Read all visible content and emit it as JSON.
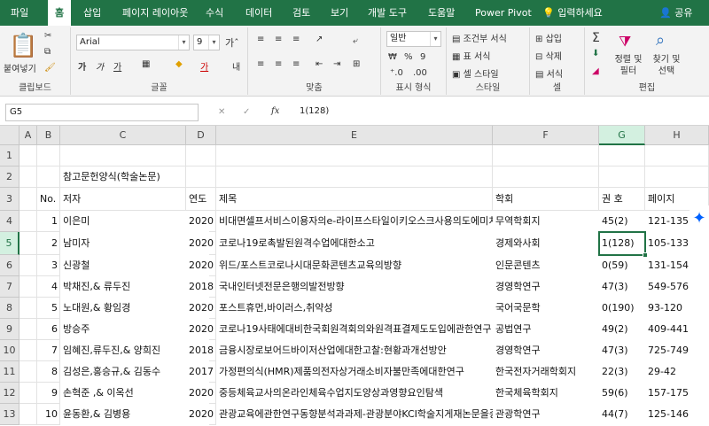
{
  "tabs": [
    "파일",
    "홈",
    "삽입",
    "페이지 레이아웃",
    "수식",
    "데이터",
    "검토",
    "보기",
    "개발 도구",
    "도움말",
    "Power Pivot"
  ],
  "active_tab": "홈",
  "tell_me": "입력하세요",
  "share": "공유",
  "ribbon": {
    "paste": "붙여넣기",
    "clipboard": "클립보드",
    "font_name": "Arial",
    "font_size": "9",
    "font_group": "글꼴",
    "align_group": "맞춤",
    "number_format": "일반",
    "number_group": "표시 형식",
    "cond_format": "조건부 서식",
    "table_format": "표 서식",
    "cell_style": "셀 스타일",
    "style_group": "스타일",
    "insert": "삽입",
    "delete": "삭제",
    "format": "서식",
    "cells_group": "셀",
    "sort_filter": "정렬 및 필터",
    "find_select": "찾기 및 선택",
    "edit_group": "편집"
  },
  "formula_bar": {
    "name_box": "G5",
    "formula": "1(128)"
  },
  "columns": [
    "A",
    "B",
    "C",
    "D",
    "E",
    "F",
    "G",
    "H"
  ],
  "selected_column": "G",
  "selected_row": "5",
  "title": "참고문헌양식(학술논문)",
  "header": {
    "no": "No.",
    "author": "저자",
    "year": "연도",
    "subject": "제목",
    "journal": "학회",
    "vol": "권 호",
    "page": "페이지"
  },
  "rows": [
    {
      "row": "4",
      "no": "1",
      "author": "이은미",
      "year": "2020",
      "subject": "비대면셀프서비스이용자의e-라이프스타일이키오스크사용의도에미치는영향",
      "journal": "무역학회지",
      "vol": "45(2)",
      "page": "121-135"
    },
    {
      "row": "5",
      "no": "2",
      "author": "남미자",
      "year": "2020",
      "subject": "코로나19로촉발된원격수업에대한소고",
      "journal": "경제와사회",
      "vol": "1(128)",
      "page": "105-133"
    },
    {
      "row": "6",
      "no": "3",
      "author": "신광철",
      "year": "2020",
      "subject": "위드/포스트코로나시대문화콘텐츠교육의방향",
      "journal": "인문콘텐츠",
      "vol": "0(59)",
      "page": "131-154"
    },
    {
      "row": "7",
      "no": "4",
      "author": "박채진,& 류두진",
      "year": "2018",
      "subject": "국내인터넷전문은행의발전방향",
      "journal": "경영학연구",
      "vol": "47(3)",
      "page": "549-576"
    },
    {
      "row": "8",
      "no": "5",
      "author": "노대원,& 황임경",
      "year": "2020",
      "subject": "포스트휴먼,바이러스,취약성",
      "journal": "국어국문학",
      "vol": "0(190)",
      "page": "93-120"
    },
    {
      "row": "9",
      "no": "6",
      "author": "방승주",
      "year": "2020",
      "subject": "코로나19사태에대비한국회원격회의와원격표결제도도입에관한연구",
      "journal": "공법연구",
      "vol": "49(2)",
      "page": "409-441"
    },
    {
      "row": "10",
      "no": "7",
      "author": "임혜진,류두진,& 양희진",
      "year": "2018",
      "subject": "금융시장로보어드바이저산업에대한고찰:현황과개선방안",
      "journal": "경영학연구",
      "vol": "47(3)",
      "page": "725-749"
    },
    {
      "row": "11",
      "no": "8",
      "author": "김성은,홍승규,& 김동수",
      "year": "2017",
      "subject": "가정편의식(HMR)제품의전자상거래소비자불만족에대한연구",
      "journal": "한국전자거래학회지",
      "vol": "22(3)",
      "page": "29-42"
    },
    {
      "row": "12",
      "no": "9",
      "author": "손혁준 ,& 이옥선",
      "year": "2020",
      "subject": "중등체육교사의온라인체육수업지도양상과영향요인탐색",
      "journal": "한국체육학회지",
      "vol": "59(6)",
      "page": "157-175"
    },
    {
      "row": "13",
      "no": "10",
      "author": "윤동환,& 김병용",
      "year": "2020",
      "subject": "관광교육에관한연구동향분석과과제-관광분야KCI학술지게재논문을중심으로",
      "journal": "관광학연구",
      "vol": "44(7)",
      "page": "125-146"
    }
  ]
}
